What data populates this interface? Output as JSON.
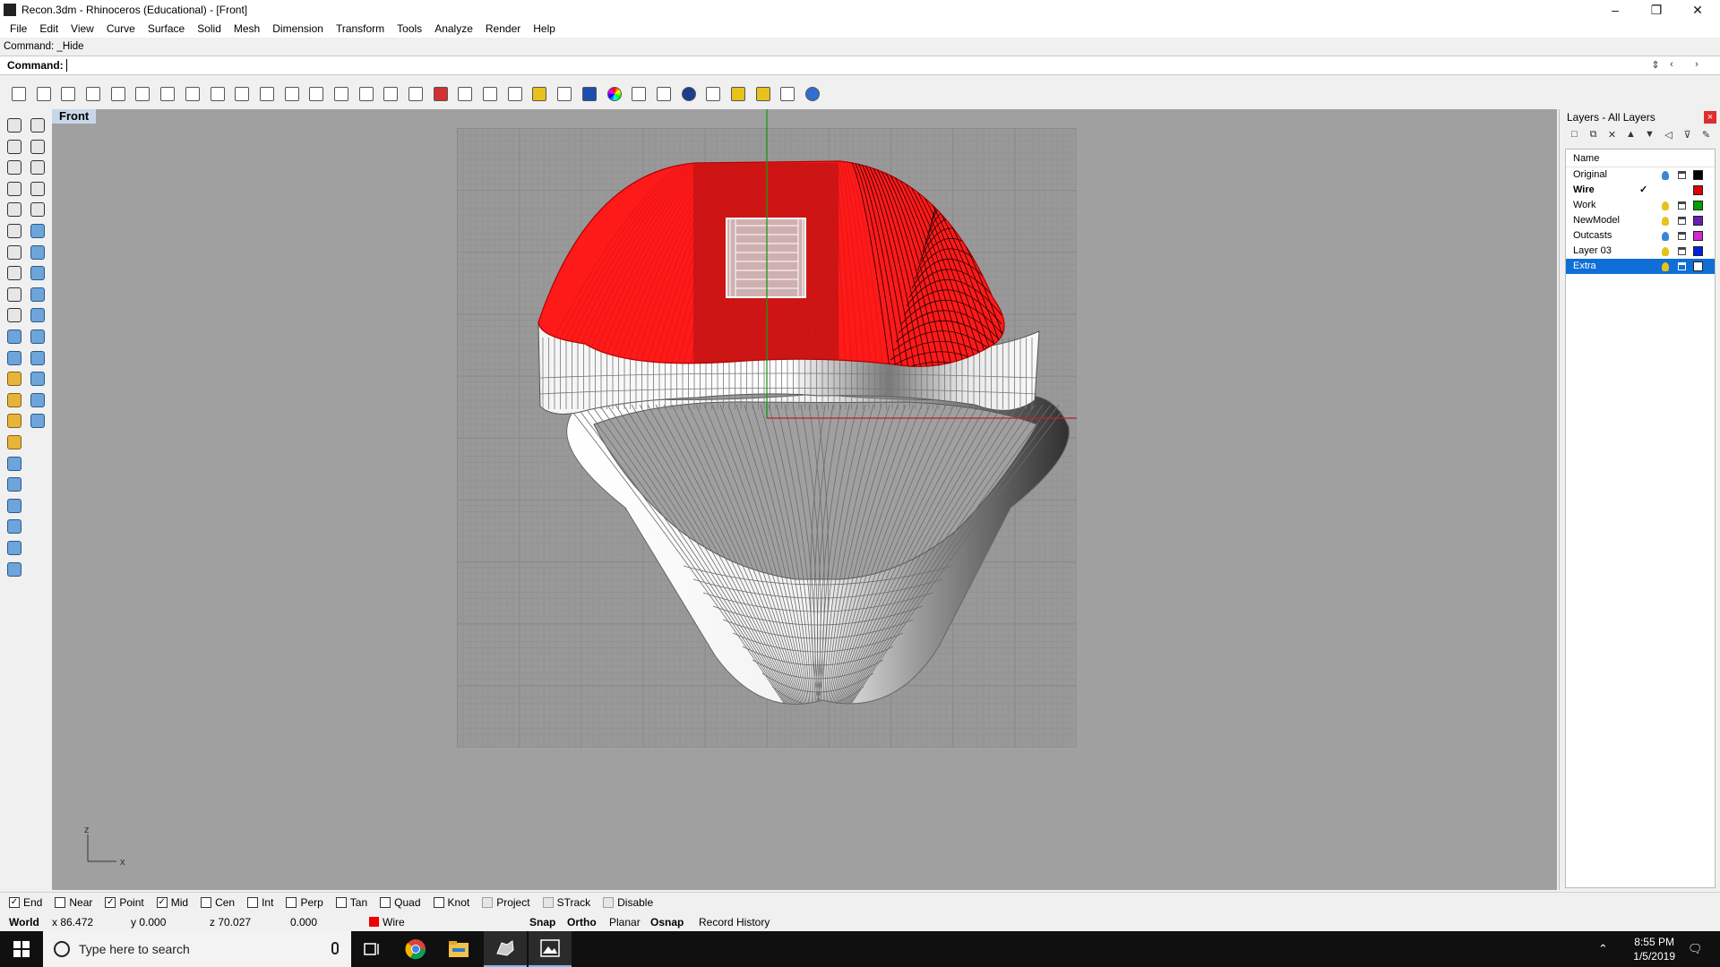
{
  "window": {
    "title": "Recon.3dm - Rhinoceros (Educational) - [Front]",
    "minimize": "–",
    "restore": "❐",
    "close": "✕"
  },
  "menu": [
    "File",
    "Edit",
    "View",
    "Curve",
    "Surface",
    "Solid",
    "Mesh",
    "Dimension",
    "Transform",
    "Tools",
    "Analyze",
    "Render",
    "Help"
  ],
  "command": {
    "history": "Command: _Hide",
    "prompt": "Command:"
  },
  "toolbar_icons": [
    "new-file-icon",
    "open-icon",
    "save-icon",
    "print-icon",
    "import-icon",
    "cut-icon",
    "copy-icon",
    "paste-icon",
    "undo-icon",
    "pan-icon",
    "rotate-view-icon",
    "zoom-window-icon",
    "zoom-dynamic-icon",
    "zoom-extents-icon",
    "zoom-selected-icon",
    "undo-view-icon",
    "viewport-layout-icon",
    "car-icon",
    "car-outline-icon",
    "hide-icon",
    "show-icon",
    "light-icon",
    "lock-icon",
    "shield-icon",
    "color-wheel-icon",
    "ghosted-icon",
    "shaded-icon",
    "render-sphere-icon",
    "rendered-icon",
    "flag-icon",
    "gear-icon",
    "toolbar-layout-icon",
    "help-icon"
  ],
  "viewport": {
    "label": "Front",
    "axis_z": "z",
    "axis_x": "x"
  },
  "layers": {
    "title": "Layers - All Layers",
    "close": "×",
    "tools": [
      "□",
      "⧉",
      "✕",
      "▲",
      "▼",
      "◁",
      "⊽",
      "✎"
    ],
    "column_name": "Name",
    "rows": [
      {
        "name": "Original",
        "color": "#000000",
        "bulb": "#3b86d6",
        "current": false,
        "selected": false,
        "check": ""
      },
      {
        "name": "Wire",
        "color": "#e00000",
        "bulb": "",
        "current": true,
        "selected": false,
        "check": "✓"
      },
      {
        "name": "Work",
        "color": "#00a000",
        "bulb": "#e8c21c",
        "current": false,
        "selected": false,
        "check": ""
      },
      {
        "name": "NewModel",
        "color": "#6a1fb0",
        "bulb": "#e8c21c",
        "current": false,
        "selected": false,
        "check": ""
      },
      {
        "name": "Outcasts",
        "color": "#d02ad0",
        "bulb": "#3b86d6",
        "current": false,
        "selected": false,
        "check": ""
      },
      {
        "name": "Layer 03",
        "color": "#0020e0",
        "bulb": "#e8c21c",
        "current": false,
        "selected": false,
        "check": ""
      },
      {
        "name": "Extra",
        "color": "#ffffff",
        "bulb": "#e8c21c",
        "current": false,
        "selected": true,
        "check": ""
      }
    ]
  },
  "osnaps": [
    {
      "label": "End",
      "checked": true,
      "enabled": true
    },
    {
      "label": "Near",
      "checked": false,
      "enabled": true
    },
    {
      "label": "Point",
      "checked": true,
      "enabled": true
    },
    {
      "label": "Mid",
      "checked": true,
      "enabled": true
    },
    {
      "label": "Cen",
      "checked": false,
      "enabled": true
    },
    {
      "label": "Int",
      "checked": false,
      "enabled": true
    },
    {
      "label": "Perp",
      "checked": false,
      "enabled": true
    },
    {
      "label": "Tan",
      "checked": false,
      "enabled": true
    },
    {
      "label": "Quad",
      "checked": false,
      "enabled": true
    },
    {
      "label": "Knot",
      "checked": false,
      "enabled": true
    },
    {
      "label": "Project",
      "checked": false,
      "enabled": false
    },
    {
      "label": "STrack",
      "checked": false,
      "enabled": false
    },
    {
      "label": "Disable",
      "checked": false,
      "enabled": false
    }
  ],
  "status": {
    "cplane": "World",
    "x": "x 86.472",
    "y": "y 0.000",
    "z": "z 70.027",
    "distance": "0.000",
    "layer": "Wire",
    "snap": "Snap",
    "ortho": "Ortho",
    "planar": "Planar",
    "osnap": "Osnap",
    "history": "Record History"
  },
  "taskbar": {
    "search_placeholder": "Type here to search",
    "time": "8:55 PM",
    "date": "1/5/2019",
    "tray_chevron": "⌃",
    "notifications": "🗨"
  },
  "colors": {
    "viewport_bg": "#a0a0a0",
    "helmet_red": "#ff1a1a",
    "selection_blue": "#0f6fd6"
  }
}
